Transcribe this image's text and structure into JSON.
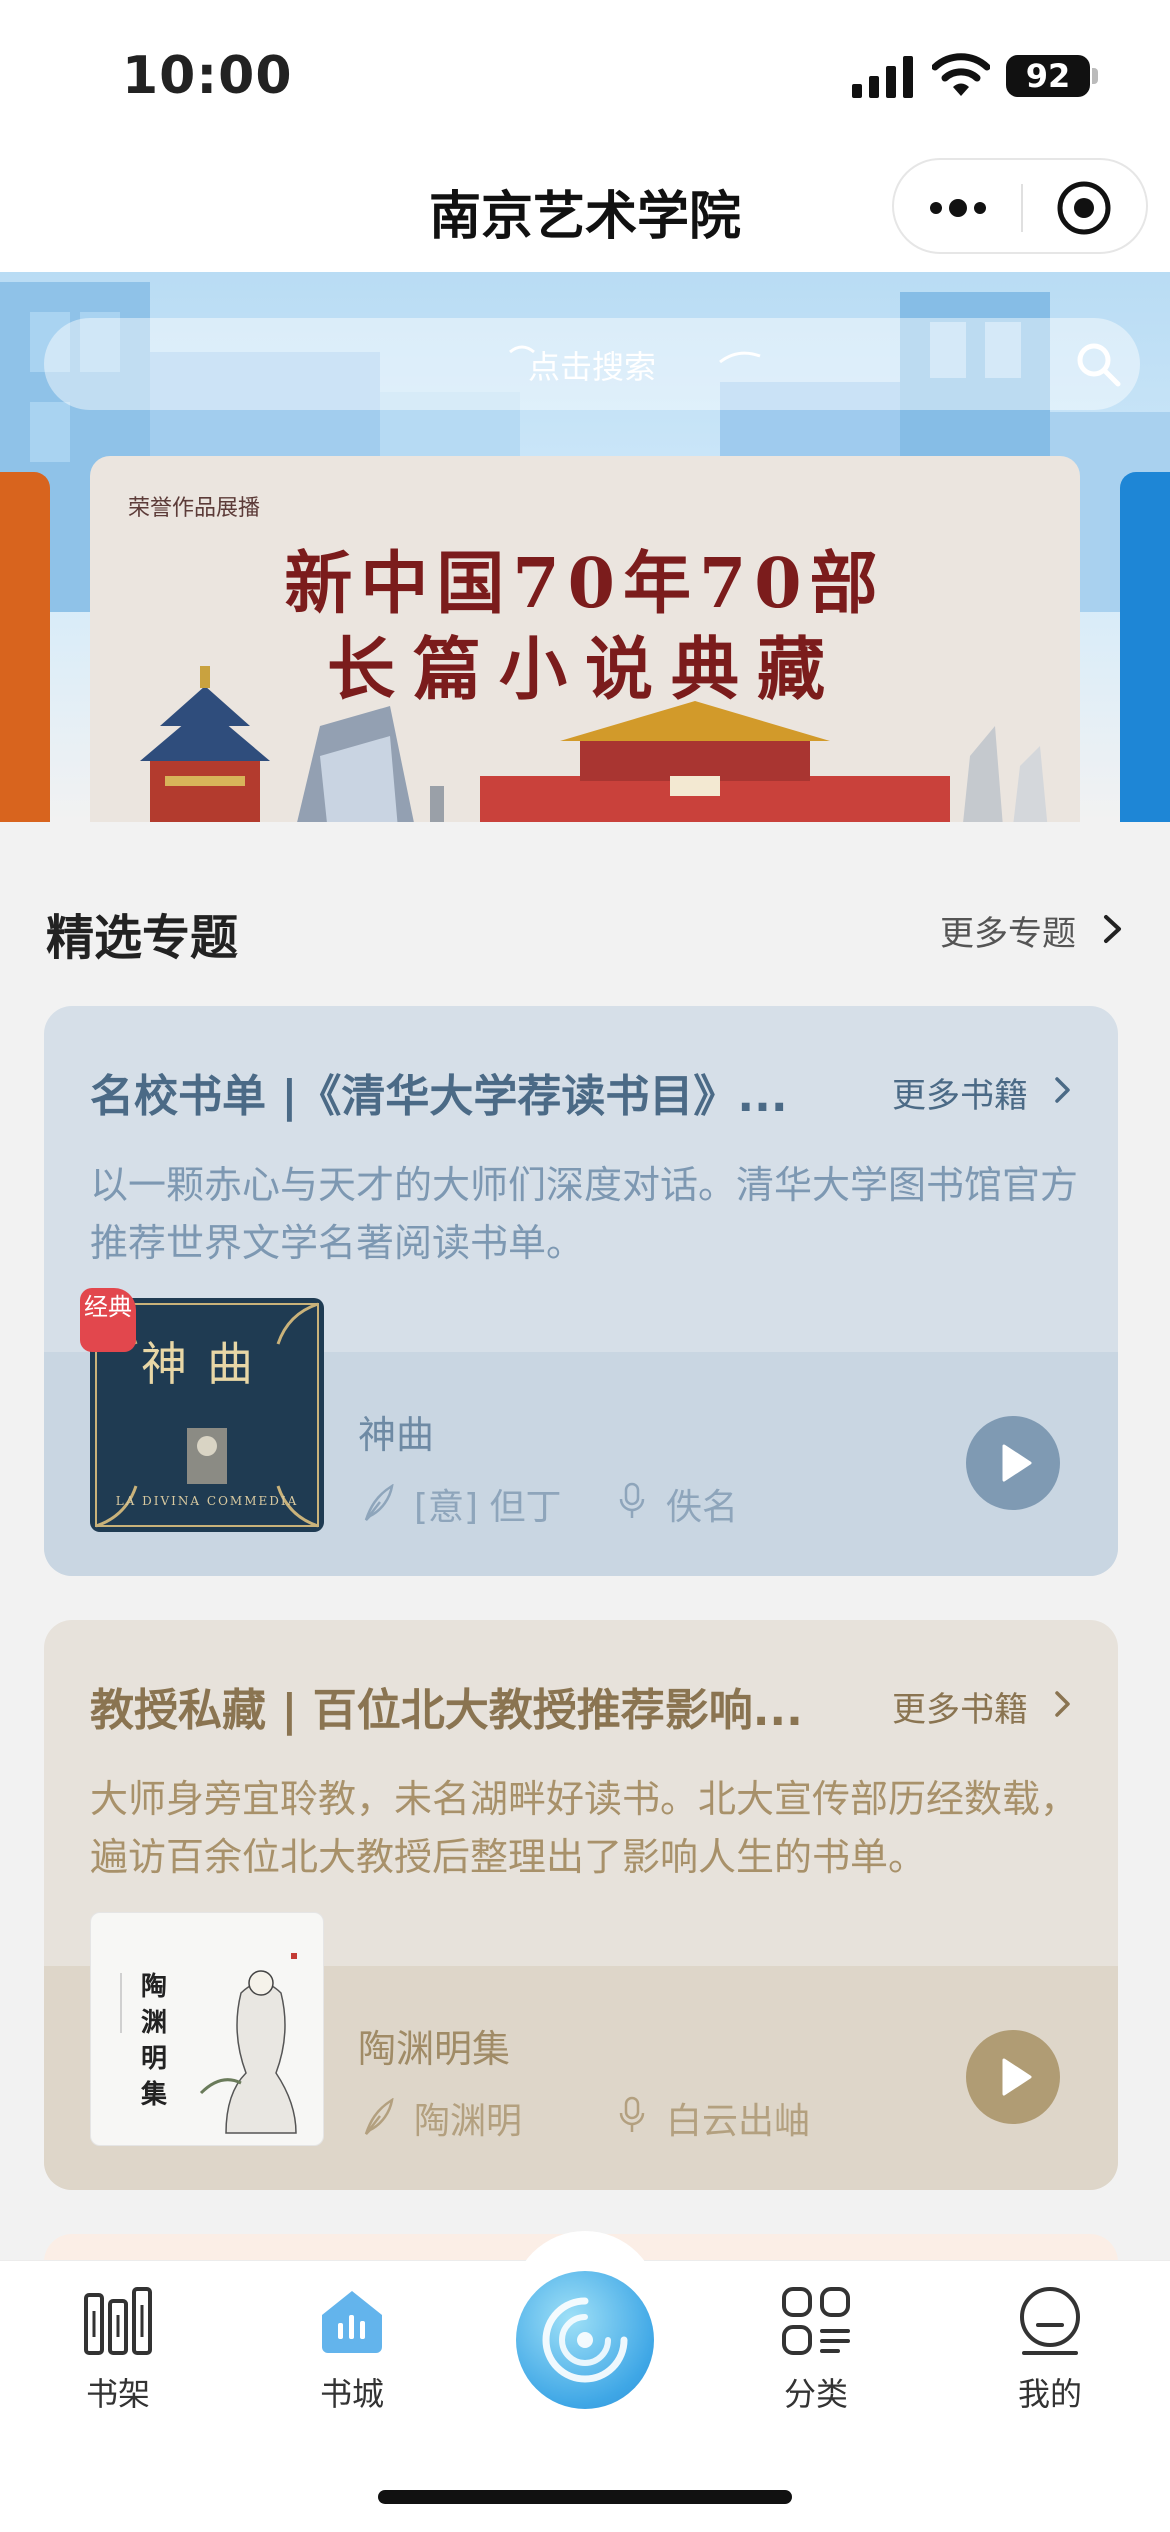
{
  "status_bar": {
    "time": "10:00",
    "battery": "92"
  },
  "nav": {
    "title": "南京艺术学院"
  },
  "search": {
    "placeholder": "点击搜索"
  },
  "banner": {
    "label": "荣誉作品展播",
    "line1": "新中国70年70部",
    "line2": "长篇小说典藏"
  },
  "section": {
    "title": "精选专题",
    "more_label": "更多专题"
  },
  "cards": [
    {
      "title": "名校书单 |《清华大学荐读书目》...",
      "more_label": "更多书籍",
      "description": "以一颗赤心与天才的大师们深度对话。清华大学图书馆官方推荐世界文学名著阅读书单。",
      "badge": "经典",
      "cover_title": "神曲",
      "cover_subtitle": "LA DIVINA COMMEDIA",
      "book_name": "神曲",
      "author": "[意] 但丁",
      "narrator": "佚名",
      "accent": "#7f9ab3"
    },
    {
      "title": "教授私藏 | 百位北大教授推荐影响...",
      "more_label": "更多书籍",
      "description": "大师身旁宜聆教，未名湖畔好读书。北大宣传部历经数载，遍访百余位北大教授后整理出了影响人生的书单。",
      "cover_title": "陶渊明集",
      "book_name": "陶渊明集",
      "author": "陶渊明",
      "narrator": "白云出岫",
      "accent": "#b09c74"
    }
  ],
  "tabs": [
    {
      "label": "书架",
      "icon": "bookshelf-icon"
    },
    {
      "label": "书城",
      "icon": "bookstore-icon",
      "active": true
    },
    {
      "label": "",
      "icon": "player-orb-icon"
    },
    {
      "label": "分类",
      "icon": "category-icon"
    },
    {
      "label": "我的",
      "icon": "profile-icon"
    }
  ]
}
